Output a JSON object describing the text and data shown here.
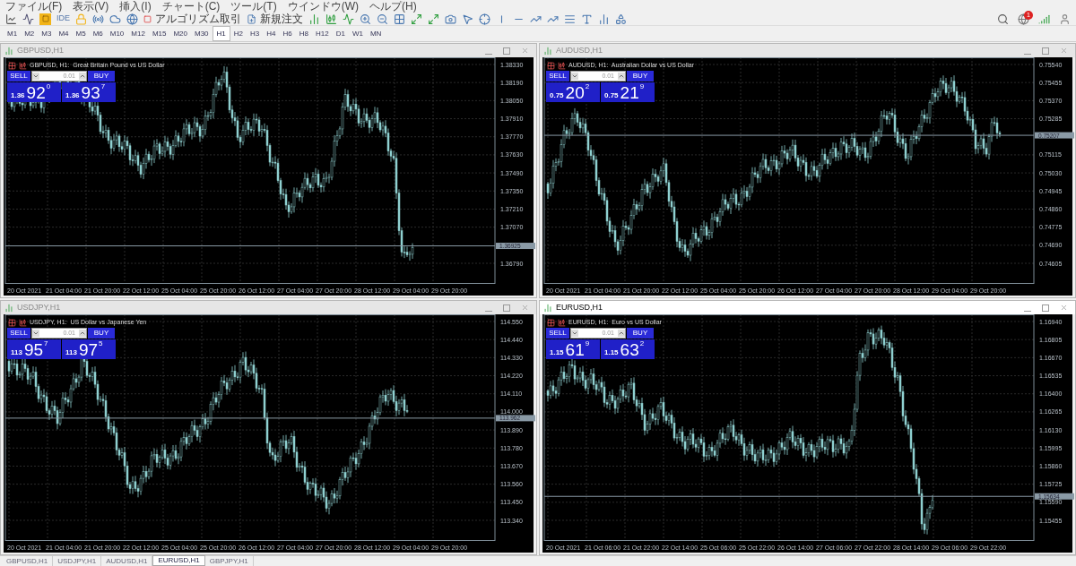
{
  "menu": [
    "ファイル(F)",
    "表示(V)",
    "挿入(I)",
    "チャート(C)",
    "ツール(T)",
    "ウインドウ(W)",
    "ヘルプ(H)"
  ],
  "toolbar": {
    "ide": "IDE",
    "algo": "アルゴリズム取引",
    "new_order": "新規注文",
    "notification_count": "1"
  },
  "timeframes": [
    {
      "label": "M1",
      "selected": false
    },
    {
      "label": "M2",
      "selected": false
    },
    {
      "label": "M3",
      "selected": false
    },
    {
      "label": "M4",
      "selected": false
    },
    {
      "label": "M5",
      "selected": false
    },
    {
      "label": "M6",
      "selected": false
    },
    {
      "label": "M10",
      "selected": false
    },
    {
      "label": "M12",
      "selected": false
    },
    {
      "label": "M15",
      "selected": false
    },
    {
      "label": "M20",
      "selected": false
    },
    {
      "label": "M30",
      "selected": false
    },
    {
      "label": "H1",
      "selected": true
    },
    {
      "label": "H2",
      "selected": false
    },
    {
      "label": "H3",
      "selected": false
    },
    {
      "label": "H4",
      "selected": false
    },
    {
      "label": "H6",
      "selected": false
    },
    {
      "label": "H8",
      "selected": false
    },
    {
      "label": "H12",
      "selected": false
    },
    {
      "label": "D1",
      "selected": false
    },
    {
      "label": "W1",
      "selected": false
    },
    {
      "label": "MN",
      "selected": false
    }
  ],
  "charts": [
    {
      "title": "GBPUSD,H1",
      "active": false,
      "header": "GBPUSD, H1:  Great Britain Pound vs US Dollar",
      "sell_label": "SELL",
      "buy_label": "BUY",
      "lot": "0.01",
      "sell": {
        "prefix": "1.36",
        "main": "92",
        "sup": "0"
      },
      "buy": {
        "prefix": "1.36",
        "main": "93",
        "sup": "7"
      },
      "price_labels": [
        "1.38330",
        "1.38190",
        "1.38050",
        "1.37910",
        "1.37770",
        "1.37630",
        "1.37490",
        "1.37350",
        "1.37210",
        "1.37070",
        "1.36790"
      ],
      "current_price": "1.36925",
      "time_labels": [
        "20 Oct 2021",
        "21 Oct 04:00",
        "21 Oct 20:00",
        "22 Oct 12:00",
        "25 Oct 04:00",
        "25 Oct 20:00",
        "26 Oct 12:00",
        "27 Oct 04:00",
        "27 Oct 20:00",
        "28 Oct 12:00",
        "29 Oct 04:00",
        "29 Oct 20:00"
      ]
    },
    {
      "title": "AUDUSD,H1",
      "active": false,
      "header": "AUDUSD, H1:  Australian Dollar vs US Dollar",
      "sell_label": "SELL",
      "buy_label": "BUY",
      "lot": "0.01",
      "sell": {
        "prefix": "0.75",
        "main": "20",
        "sup": "2"
      },
      "buy": {
        "prefix": "0.75",
        "main": "21",
        "sup": "9"
      },
      "price_labels": [
        "0.75540",
        "0.75455",
        "0.75370",
        "0.75285",
        "0.75115",
        "0.75030",
        "0.74945",
        "0.74860",
        "0.74775",
        "0.74690",
        "0.74605"
      ],
      "current_price": "0.75207",
      "time_labels": [
        "20 Oct 2021",
        "21 Oct 04:00",
        "21 Oct 20:00",
        "22 Oct 12:00",
        "25 Oct 04:00",
        "25 Oct 20:00",
        "26 Oct 12:00",
        "27 Oct 04:00",
        "27 Oct 20:00",
        "28 Oct 12:00",
        "29 Oct 04:00",
        "29 Oct 20:00"
      ]
    },
    {
      "title": "USDJPY,H1",
      "active": false,
      "header": "USDJPY, H1:  US Dollar vs Japanese Yen",
      "sell_label": "SELL",
      "buy_label": "BUY",
      "lot": "0.01",
      "sell": {
        "prefix": "113",
        "main": "95",
        "sup": "7"
      },
      "buy": {
        "prefix": "113",
        "main": "97",
        "sup": "5"
      },
      "price_labels": [
        "114.550",
        "114.440",
        "114.330",
        "114.220",
        "114.110",
        "114.000",
        "113.890",
        "113.780",
        "113.670",
        "113.560",
        "113.450",
        "113.340"
      ],
      "current_price": "113.962",
      "time_labels": [
        "20 Oct 2021",
        "21 Oct 04:00",
        "21 Oct 20:00",
        "22 Oct 12:00",
        "25 Oct 04:00",
        "25 Oct 20:00",
        "26 Oct 12:00",
        "27 Oct 04:00",
        "27 Oct 20:00",
        "28 Oct 12:00",
        "29 Oct 04:00",
        "29 Oct 20:00"
      ]
    },
    {
      "title": "EURUSD,H1",
      "active": true,
      "header": "EURUSD, H1:  Euro vs US Dollar",
      "sell_label": "SELL",
      "buy_label": "BUY",
      "lot": "0.01",
      "sell": {
        "prefix": "1.15",
        "main": "61",
        "sup": "9"
      },
      "buy": {
        "prefix": "1.15",
        "main": "63",
        "sup": "2"
      },
      "price_labels": [
        "1.16940",
        "1.16805",
        "1.16670",
        "1.16535",
        "1.16400",
        "1.16265",
        "1.16130",
        "1.15995",
        "1.15860",
        "1.15725",
        "1.15590",
        "1.15455"
      ],
      "current_price": "1.15634",
      "time_labels": [
        "20 Oct 2021",
        "21 Oct 06:00",
        "21 Oct 22:00",
        "22 Oct 14:00",
        "25 Oct 06:00",
        "25 Oct 22:00",
        "26 Oct 14:00",
        "27 Oct 06:00",
        "27 Oct 22:00",
        "28 Oct 14:00",
        "29 Oct 06:00",
        "29 Oct 22:00"
      ]
    }
  ],
  "tabs": [
    {
      "label": "GBPUSD,H1",
      "selected": false
    },
    {
      "label": "USDJPY,H1",
      "selected": false
    },
    {
      "label": "AUDUSD,H1",
      "selected": false
    },
    {
      "label": "EURUSD,H1",
      "selected": true
    },
    {
      "label": "GBPJPY,H1",
      "selected": false
    }
  ]
}
